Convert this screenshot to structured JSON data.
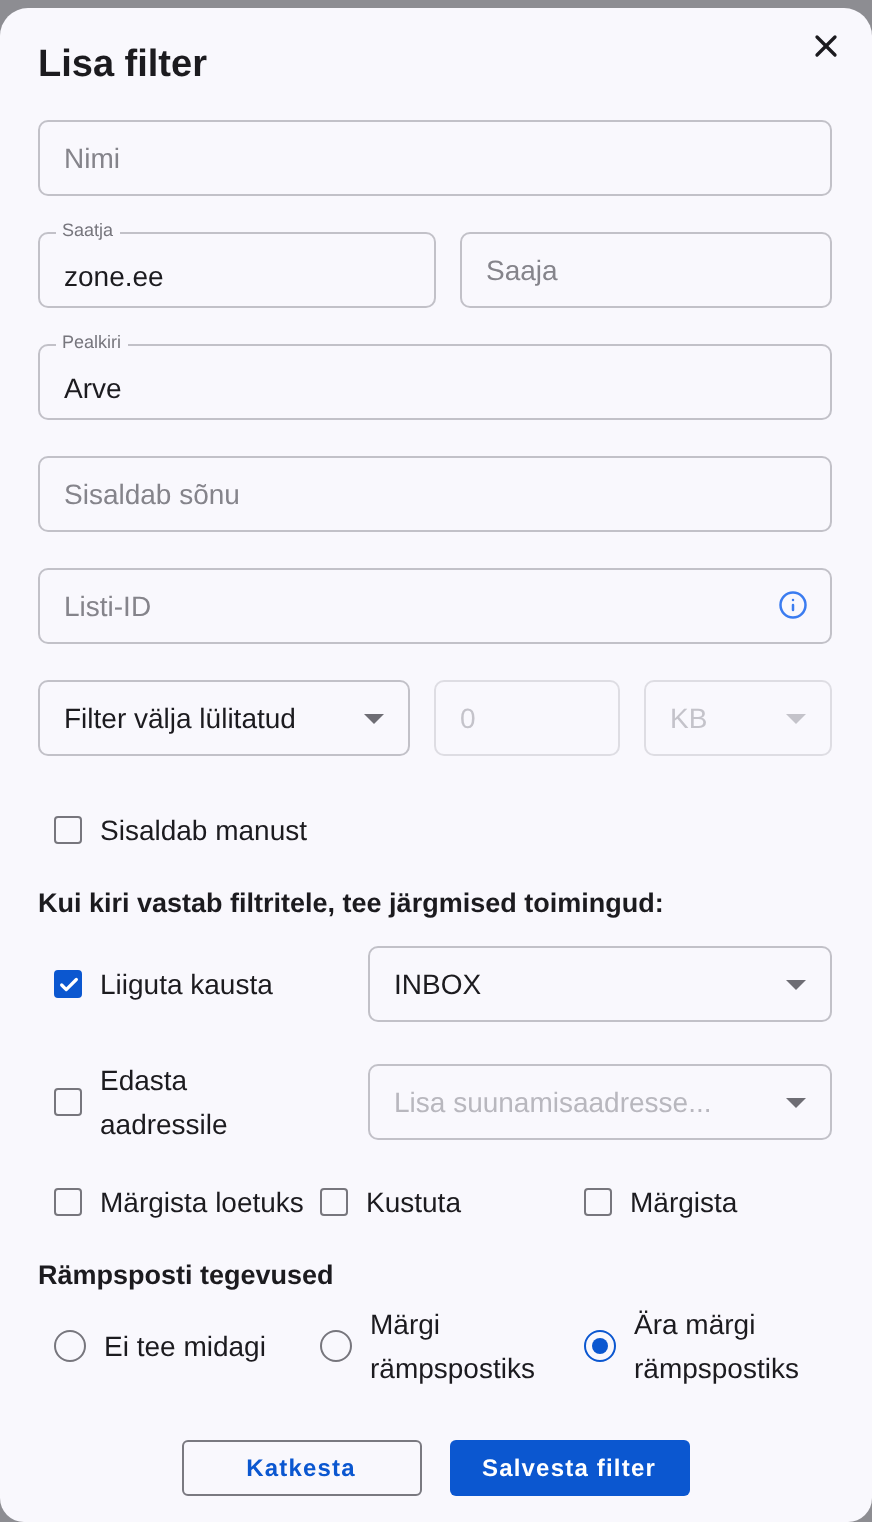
{
  "dialog": {
    "title": "Lisa filter"
  },
  "name_field": {
    "placeholder": "Nimi"
  },
  "sender_field": {
    "label": "Saatja",
    "value": "zone.ee"
  },
  "recipient_field": {
    "placeholder": "Saaja"
  },
  "subject_field": {
    "label": "Pealkiri",
    "value": "Arve"
  },
  "contains_field": {
    "placeholder": "Sisaldab sõnu"
  },
  "list_id_field": {
    "placeholder": "Listi-ID"
  },
  "size_filter": {
    "mode": "Filter välja lülitatud",
    "size": {
      "placeholder": "0",
      "disabled": true
    },
    "unit": {
      "value": "KB",
      "disabled": true
    }
  },
  "has_attachment": {
    "label": "Sisaldab manust",
    "checked": false
  },
  "actions_heading": "Kui kiri vastab filtritele, tee järgmised toimingud:",
  "actions": [
    {
      "label": "Liiguta kausta",
      "checked": true,
      "select": {
        "value": "INBOX"
      }
    },
    {
      "label": "Edasta aadressile",
      "checked": false,
      "select": {
        "placeholder": "Lisa suunamisaadresse..."
      }
    }
  ],
  "flags": [
    {
      "label": "Märgista loetuks",
      "checked": false
    },
    {
      "label": "Kustuta",
      "checked": false
    },
    {
      "label": "Märgista",
      "checked": false
    }
  ],
  "spam_heading": "Rämpsposti tegevused",
  "spam_options": [
    {
      "label": "Ei tee midagi",
      "selected": false
    },
    {
      "label": "Märgi rämpspostiks",
      "selected": false
    },
    {
      "label": "Ära märgi rämpspostiks",
      "selected": true
    }
  ],
  "buttons": [
    {
      "kind": "outline",
      "label": "Katkesta"
    },
    {
      "kind": "primary",
      "label": "Salvesta filter"
    }
  ]
}
